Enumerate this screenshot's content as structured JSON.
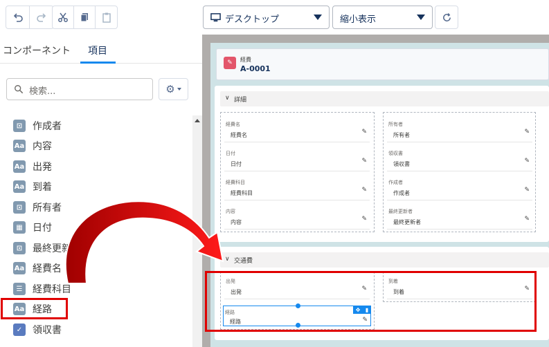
{
  "toolbar": {
    "device_select": "デスクトップ",
    "zoom_select": "縮小表示"
  },
  "left_panel": {
    "tabs": [
      {
        "label": "コンポーネント"
      },
      {
        "label": "項目"
      }
    ],
    "search": {
      "placeholder": "検索..."
    },
    "fields": [
      {
        "label": "作成者",
        "icon": "lookup-icon"
      },
      {
        "label": "内容",
        "icon": "text-icon"
      },
      {
        "label": "出発",
        "icon": "text-icon"
      },
      {
        "label": "到着",
        "icon": "text-icon"
      },
      {
        "label": "所有者",
        "icon": "lookup-icon"
      },
      {
        "label": "日付",
        "icon": "calendar-icon"
      },
      {
        "label": "最終更新者",
        "icon": "lookup-icon"
      },
      {
        "label": "経費名",
        "icon": "text-icon"
      },
      {
        "label": "経費科目",
        "icon": "picklist-icon"
      },
      {
        "label": "経路",
        "icon": "text-icon"
      },
      {
        "label": "領収書",
        "icon": "checkbox-icon"
      }
    ]
  },
  "canvas": {
    "record": {
      "object": "経費",
      "name": "A-0001"
    },
    "section_detail": {
      "title": "詳細",
      "left_fields": [
        {
          "label": "経費名",
          "value": "経費名"
        },
        {
          "label": "日付",
          "value": "日付"
        },
        {
          "label": "経費科目",
          "value": "経費科目"
        },
        {
          "label": "内容",
          "value": "内容"
        }
      ],
      "right_fields": [
        {
          "label": "所有者",
          "value": "所有者"
        },
        {
          "label": "領収書",
          "value": "領収書"
        },
        {
          "label": "作成者",
          "value": "作成者"
        },
        {
          "label": "最終更新者",
          "value": "最終更新者"
        }
      ]
    },
    "section_transport": {
      "title": "交通費",
      "left_fields": [
        {
          "label": "出発",
          "value": "出発"
        },
        {
          "label": "経路",
          "value": "経路"
        }
      ],
      "right_fields": [
        {
          "label": "到着",
          "value": "到着"
        }
      ]
    }
  },
  "colors": {
    "highlight": "#e00000",
    "accent": "#1589ee",
    "canvas_bg": "#cfe3e6",
    "record_icon": "#e3566b"
  }
}
